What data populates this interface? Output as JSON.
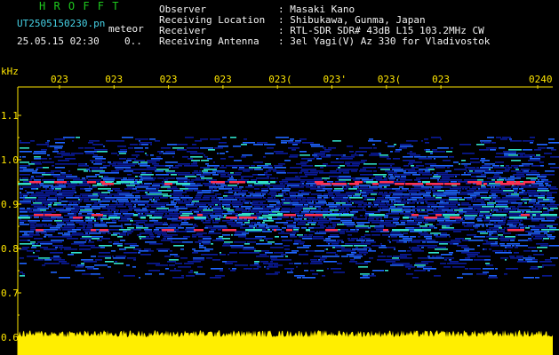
{
  "header": {
    "brand": "H R O F F T",
    "filename": "UT2505150230.pn",
    "detector": "meteor",
    "datetime": "25.05.15 02:30",
    "count": "0..",
    "info": [
      {
        "label": "Observer",
        "value": ": Masaki Kano"
      },
      {
        "label": "Receiving Location",
        "value": ": Shibukawa, Gunma, Japan"
      },
      {
        "label": "Receiver",
        "value": ": RTL-SDR SDR# 43dB L15 103.2MHz CW"
      },
      {
        "label": "Receiving Antenna",
        "value": ": 3el Yagi(V) Az 330 for Vladivostok"
      }
    ]
  },
  "chart_data": {
    "type": "heatmap",
    "ylabel": "kHz",
    "y_ticks": [
      "1.1",
      "1.0",
      "0.9",
      "0.8",
      "0.7",
      "0.6"
    ],
    "y_tick_values": [
      1.1,
      1.0,
      0.9,
      0.8,
      0.7,
      0.6
    ],
    "ylim": [
      0.6,
      1.2
    ],
    "x_ticks": [
      "023",
      "023",
      "023",
      "023",
      "023(",
      "023'",
      "023(",
      "023",
      "0240"
    ],
    "colors": {
      "background": "#000000",
      "band_low": "#0a1a9a",
      "band_mid": "#1e64ff",
      "band_high": "#30e0c8",
      "strong": "#ff3050",
      "noise_floor": "#ffee00",
      "axis_text": "#ffe600"
    }
  }
}
